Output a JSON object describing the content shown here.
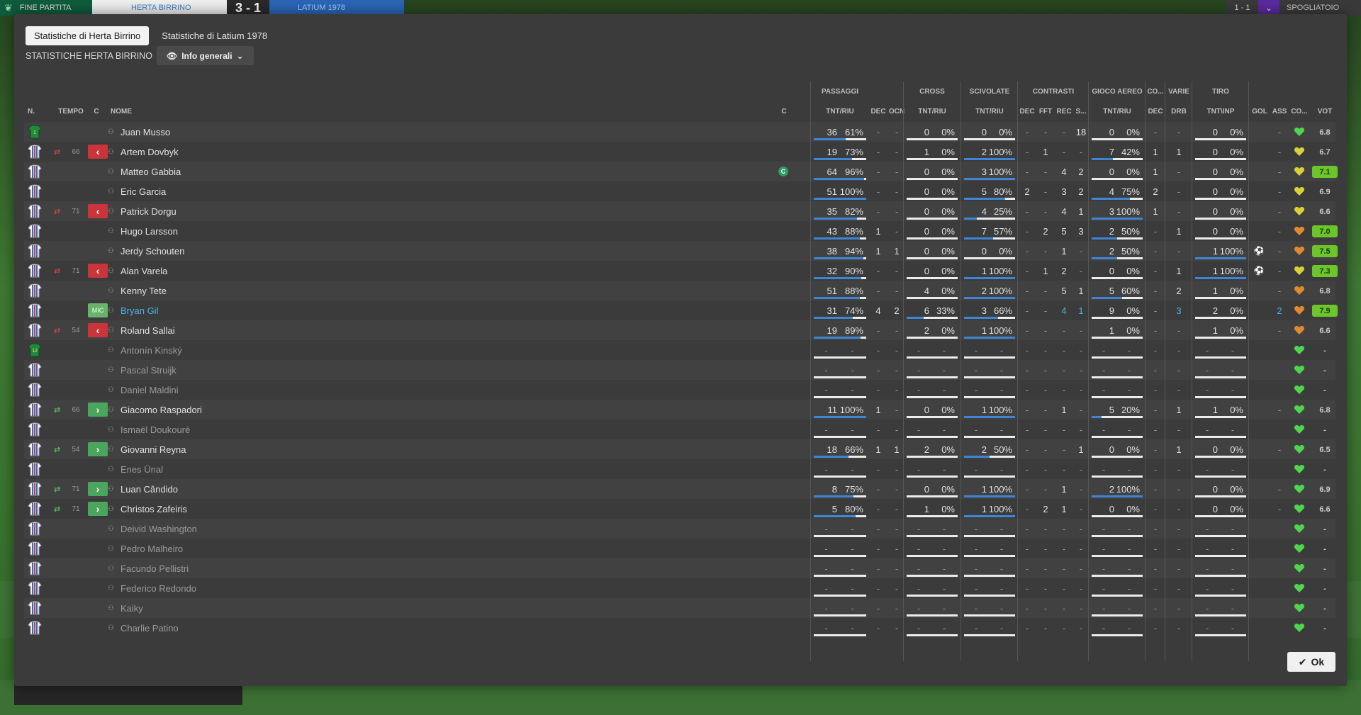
{
  "topbar": {
    "end_label": "FINE PARTITA",
    "home_team": "HERTA BIRRINO",
    "score": "3 - 1",
    "away_team": "LATIUM 1978",
    "right_score": "1 - 1",
    "right_label": "SPOGLIATOIO"
  },
  "tabs": [
    {
      "label": "Statistiche di Herta Birrino",
      "active": true
    },
    {
      "label": "Statistiche di Latium 1978",
      "active": false
    }
  ],
  "section_label": "STATISTICHE HERTA BIRRINO",
  "view_dropdown": "Info generali",
  "groups": [
    "PASSAGGI",
    "CROSS",
    "SCIVOLATE",
    "CONTRASTI",
    "GIOCO AEREO",
    "CO...",
    "VARIE",
    "TIRO"
  ],
  "headers": {
    "n": "N.",
    "tempo": "TEMPO",
    "c": "C",
    "nome": "NOME",
    "cap": "C",
    "p_tnt": "TNT/RIU",
    "p_dec": "DEC",
    "p_ocn": "OCN",
    "cr_tnt": "TNT/RIU",
    "sc_tnt": "TNT/RIU",
    "co_dec": "DEC",
    "co_fft": "FFT",
    "co_rec": "REC",
    "co_s": "S...",
    "ga_tnt": "TNT/RIU",
    "cm_dec": "DEC",
    "va_drb": "DRB",
    "ti_tnt": "TNT\\INP",
    "gol": "GOL",
    "ass": "ASS",
    "cond": "CO...",
    "vot": "VOT"
  },
  "players": [
    {
      "num": "1",
      "gk": true,
      "sub": "",
      "min": "",
      "pos": "",
      "name": "Juan Musso",
      "dim": false,
      "link": false,
      "cap": false,
      "p": [
        "36",
        "61%"
      ],
      "pdec": "-",
      "pocn": "-",
      "cr": [
        "0",
        "0%"
      ],
      "sc": [
        "0",
        "0%"
      ],
      "codec": "-",
      "cofft": "-",
      "corec": "-",
      "cos": "18",
      "ga": [
        "0",
        "0%"
      ],
      "cmdec": "-",
      "drb": "-",
      "ti": [
        "0",
        "0%"
      ],
      "gol": "",
      "ass": "-",
      "heart": "green",
      "vot": "6.8",
      "hi": false,
      "pfill": 61,
      "crfill": 0,
      "scfill": 0,
      "gafill": 0,
      "tifill": 0
    },
    {
      "num": "",
      "gk": false,
      "sub": "out",
      "min": "66",
      "pos": "",
      "name": "Artem Dovbyk",
      "dim": false,
      "link": false,
      "cap": false,
      "p": [
        "19",
        "73%"
      ],
      "pdec": "-",
      "pocn": "-",
      "cr": [
        "1",
        "0%"
      ],
      "sc": [
        "2",
        "100%"
      ],
      "codec": "-",
      "cofft": "1",
      "corec": "-",
      "cos": "-",
      "ga": [
        "7",
        "42%"
      ],
      "cmdec": "1",
      "drb": "1",
      "ti": [
        "0",
        "0%"
      ],
      "gol": "",
      "ass": "-",
      "heart": "yellow",
      "vot": "6.7",
      "hi": false,
      "pfill": 73,
      "crfill": 0,
      "scfill": 100,
      "gafill": 42,
      "tifill": 0
    },
    {
      "num": "",
      "gk": false,
      "sub": "",
      "min": "",
      "pos": "",
      "name": "Matteo Gabbia",
      "dim": false,
      "link": false,
      "cap": true,
      "p": [
        "64",
        "96%"
      ],
      "pdec": "-",
      "pocn": "-",
      "cr": [
        "0",
        "0%"
      ],
      "sc": [
        "3",
        "100%"
      ],
      "codec": "-",
      "cofft": "-",
      "corec": "4",
      "cos": "2",
      "ga": [
        "0",
        "0%"
      ],
      "cmdec": "1",
      "drb": "-",
      "ti": [
        "0",
        "0%"
      ],
      "gol": "",
      "ass": "-",
      "heart": "yellow",
      "vot": "7.1",
      "hi": true,
      "pfill": 96,
      "crfill": 0,
      "scfill": 100,
      "gafill": 0,
      "tifill": 0
    },
    {
      "num": "",
      "gk": false,
      "sub": "",
      "min": "",
      "pos": "",
      "name": "Eric Garcia",
      "dim": false,
      "link": false,
      "cap": false,
      "p": [
        "51",
        "100%"
      ],
      "pdec": "-",
      "pocn": "-",
      "cr": [
        "0",
        "0%"
      ],
      "sc": [
        "5",
        "80%"
      ],
      "codec": "2",
      "cofft": "-",
      "corec": "3",
      "cos": "2",
      "ga": [
        "4",
        "75%"
      ],
      "cmdec": "2",
      "drb": "-",
      "ti": [
        "0",
        "0%"
      ],
      "gol": "",
      "ass": "-",
      "heart": "yellow",
      "vot": "6.9",
      "hi": false,
      "pfill": 100,
      "crfill": 0,
      "scfill": 80,
      "gafill": 75,
      "tifill": 0
    },
    {
      "num": "",
      "gk": false,
      "sub": "out",
      "min": "71",
      "pos": "",
      "name": "Patrick Dorgu",
      "dim": false,
      "link": false,
      "cap": false,
      "p": [
        "35",
        "82%"
      ],
      "pdec": "-",
      "pocn": "-",
      "cr": [
        "0",
        "0%"
      ],
      "sc": [
        "4",
        "25%"
      ],
      "codec": "-",
      "cofft": "-",
      "corec": "4",
      "cos": "1",
      "ga": [
        "3",
        "100%"
      ],
      "cmdec": "1",
      "drb": "-",
      "ti": [
        "0",
        "0%"
      ],
      "gol": "",
      "ass": "-",
      "heart": "yellow",
      "vot": "6.6",
      "hi": false,
      "pfill": 82,
      "crfill": 0,
      "scfill": 25,
      "gafill": 100,
      "tifill": 0
    },
    {
      "num": "",
      "gk": false,
      "sub": "",
      "min": "",
      "pos": "",
      "name": "Hugo Larsson",
      "dim": false,
      "link": false,
      "cap": false,
      "p": [
        "43",
        "88%"
      ],
      "pdec": "1",
      "pocn": "-",
      "cr": [
        "0",
        "0%"
      ],
      "sc": [
        "7",
        "57%"
      ],
      "codec": "-",
      "cofft": "2",
      "corec": "5",
      "cos": "3",
      "ga": [
        "2",
        "50%"
      ],
      "cmdec": "-",
      "drb": "1",
      "ti": [
        "0",
        "0%"
      ],
      "gol": "",
      "ass": "-",
      "heart": "orange",
      "vot": "7.0",
      "hi": true,
      "pfill": 88,
      "crfill": 0,
      "scfill": 57,
      "gafill": 50,
      "tifill": 0
    },
    {
      "num": "",
      "gk": false,
      "sub": "",
      "min": "",
      "pos": "",
      "name": "Jerdy Schouten",
      "dim": false,
      "link": false,
      "cap": false,
      "p": [
        "38",
        "94%"
      ],
      "pdec": "1",
      "pocn": "1",
      "cr": [
        "0",
        "0%"
      ],
      "sc": [
        "0",
        "0%"
      ],
      "codec": "-",
      "cofft": "-",
      "corec": "1",
      "cos": "-",
      "ga": [
        "2",
        "50%"
      ],
      "cmdec": "-",
      "drb": "-",
      "ti": [
        "1",
        "100%"
      ],
      "gol": "ball",
      "ass": "-",
      "heart": "orange",
      "vot": "7.5",
      "hi": true,
      "pfill": 94,
      "crfill": 0,
      "scfill": 0,
      "gafill": 50,
      "tifill": 100
    },
    {
      "num": "",
      "gk": false,
      "sub": "out",
      "min": "71",
      "pos": "",
      "name": "Alan Varela",
      "dim": false,
      "link": false,
      "cap": false,
      "p": [
        "32",
        "90%"
      ],
      "pdec": "-",
      "pocn": "-",
      "cr": [
        "0",
        "0%"
      ],
      "sc": [
        "1",
        "100%"
      ],
      "codec": "-",
      "cofft": "1",
      "corec": "2",
      "cos": "-",
      "ga": [
        "0",
        "0%"
      ],
      "cmdec": "-",
      "drb": "1",
      "ti": [
        "1",
        "100%"
      ],
      "gol": "ball",
      "ass": "-",
      "heart": "yellow",
      "vot": "7.3",
      "hi": true,
      "pfill": 90,
      "crfill": 0,
      "scfill": 100,
      "gafill": 0,
      "tifill": 100
    },
    {
      "num": "",
      "gk": false,
      "sub": "",
      "min": "",
      "pos": "",
      "name": "Kenny Tete",
      "dim": false,
      "link": false,
      "cap": false,
      "p": [
        "51",
        "88%"
      ],
      "pdec": "-",
      "pocn": "-",
      "cr": [
        "4",
        "0%"
      ],
      "sc": [
        "2",
        "100%"
      ],
      "codec": "-",
      "cofft": "-",
      "corec": "5",
      "cos": "1",
      "ga": [
        "5",
        "60%"
      ],
      "cmdec": "-",
      "drb": "2",
      "ti": [
        "1",
        "0%"
      ],
      "gol": "",
      "ass": "-",
      "heart": "orange",
      "vot": "6.8",
      "hi": false,
      "pfill": 88,
      "crfill": 0,
      "scfill": 100,
      "gafill": 60,
      "tifill": 0
    },
    {
      "num": "",
      "gk": false,
      "sub": "",
      "min": "",
      "pos": "MIC",
      "name": "Bryan Gil",
      "dim": false,
      "link": true,
      "cap": false,
      "p": [
        "31",
        "74%"
      ],
      "pdec": "4",
      "pocn": "2",
      "cr": [
        "6",
        "33%"
      ],
      "sc": [
        "3",
        "66%"
      ],
      "codec": "-",
      "cofft": "-",
      "corec": "4",
      "cos": "1",
      "ga": [
        "9",
        "0%"
      ],
      "cmdec": "-",
      "drb": "3",
      "ti": [
        "2",
        "0%"
      ],
      "gol": "",
      "ass": "2",
      "heart": "orange",
      "vot": "7.9",
      "hi": true,
      "pfill": 74,
      "crfill": 33,
      "scfill": 66,
      "gafill": 0,
      "tifill": 0
    },
    {
      "num": "",
      "gk": false,
      "sub": "out",
      "min": "54",
      "pos": "",
      "name": "Roland Sallai",
      "dim": false,
      "link": false,
      "cap": false,
      "p": [
        "19",
        "89%"
      ],
      "pdec": "-",
      "pocn": "-",
      "cr": [
        "2",
        "0%"
      ],
      "sc": [
        "1",
        "100%"
      ],
      "codec": "-",
      "cofft": "-",
      "corec": "-",
      "cos": "-",
      "ga": [
        "1",
        "0%"
      ],
      "cmdec": "-",
      "drb": "-",
      "ti": [
        "1",
        "0%"
      ],
      "gol": "",
      "ass": "-",
      "heart": "orange",
      "vot": "6.6",
      "hi": false,
      "pfill": 89,
      "crfill": 0,
      "scfill": 100,
      "gafill": 0,
      "tifill": 0
    },
    {
      "num": "12",
      "gk": true,
      "sub": "",
      "min": "",
      "pos": "",
      "name": "Antonín Kinský",
      "dim": true,
      "link": false,
      "cap": false,
      "empty": true,
      "heart": "green",
      "vot": "-"
    },
    {
      "num": "",
      "gk": false,
      "sub": "",
      "min": "",
      "pos": "",
      "name": "Pascal Struijk",
      "dim": true,
      "link": false,
      "cap": false,
      "empty": true,
      "heart": "green",
      "vot": "-"
    },
    {
      "num": "",
      "gk": false,
      "sub": "",
      "min": "",
      "pos": "",
      "name": "Daniel Maldini",
      "dim": true,
      "link": false,
      "cap": false,
      "empty": true,
      "heart": "green",
      "vot": "-"
    },
    {
      "num": "",
      "gk": false,
      "sub": "in",
      "min": "66",
      "pos": "",
      "name": "Giacomo Raspadori",
      "dim": false,
      "link": false,
      "cap": false,
      "p": [
        "11",
        "100%"
      ],
      "pdec": "1",
      "pocn": "-",
      "cr": [
        "0",
        "0%"
      ],
      "sc": [
        "1",
        "100%"
      ],
      "codec": "-",
      "cofft": "-",
      "corec": "1",
      "cos": "-",
      "ga": [
        "5",
        "20%"
      ],
      "cmdec": "-",
      "drb": "1",
      "ti": [
        "1",
        "0%"
      ],
      "gol": "",
      "ass": "-",
      "heart": "green",
      "vot": "6.8",
      "hi": false,
      "pfill": 100,
      "crfill": 0,
      "scfill": 100,
      "gafill": 20,
      "tifill": 0
    },
    {
      "num": "",
      "gk": false,
      "sub": "",
      "min": "",
      "pos": "",
      "name": "Ismaël Doukouré",
      "dim": true,
      "link": false,
      "cap": false,
      "empty": true,
      "heart": "green",
      "vot": "-"
    },
    {
      "num": "",
      "gk": false,
      "sub": "in",
      "min": "54",
      "pos": "",
      "name": "Giovanni Reyna",
      "dim": false,
      "link": false,
      "cap": false,
      "p": [
        "18",
        "66%"
      ],
      "pdec": "1",
      "pocn": "1",
      "cr": [
        "2",
        "0%"
      ],
      "sc": [
        "2",
        "50%"
      ],
      "codec": "-",
      "cofft": "-",
      "corec": "-",
      "cos": "1",
      "ga": [
        "0",
        "0%"
      ],
      "cmdec": "-",
      "drb": "1",
      "ti": [
        "0",
        "0%"
      ],
      "gol": "",
      "ass": "-",
      "heart": "green",
      "vot": "6.5",
      "hi": false,
      "pfill": 66,
      "crfill": 0,
      "scfill": 50,
      "gafill": 0,
      "tifill": 0
    },
    {
      "num": "",
      "gk": false,
      "sub": "",
      "min": "",
      "pos": "",
      "name": "Enes Ünal",
      "dim": true,
      "link": false,
      "cap": false,
      "empty": true,
      "heart": "green",
      "vot": "-"
    },
    {
      "num": "",
      "gk": false,
      "sub": "in",
      "min": "71",
      "pos": "",
      "name": "Luan Cândido",
      "dim": false,
      "link": false,
      "cap": false,
      "p": [
        "8",
        "75%"
      ],
      "pdec": "-",
      "pocn": "-",
      "cr": [
        "0",
        "0%"
      ],
      "sc": [
        "1",
        "100%"
      ],
      "codec": "-",
      "cofft": "-",
      "corec": "1",
      "cos": "-",
      "ga": [
        "2",
        "100%"
      ],
      "cmdec": "-",
      "drb": "-",
      "ti": [
        "0",
        "0%"
      ],
      "gol": "",
      "ass": "-",
      "heart": "green",
      "vot": "6.9",
      "hi": false,
      "pfill": 75,
      "crfill": 0,
      "scfill": 100,
      "gafill": 100,
      "tifill": 0
    },
    {
      "num": "",
      "gk": false,
      "sub": "in",
      "min": "71",
      "pos": "",
      "name": "Christos Zafeiris",
      "dim": false,
      "link": false,
      "cap": false,
      "p": [
        "5",
        "80%"
      ],
      "pdec": "-",
      "pocn": "-",
      "cr": [
        "1",
        "0%"
      ],
      "sc": [
        "1",
        "100%"
      ],
      "codec": "-",
      "cofft": "2",
      "corec": "1",
      "cos": "-",
      "ga": [
        "0",
        "0%"
      ],
      "cmdec": "-",
      "drb": "-",
      "ti": [
        "0",
        "0%"
      ],
      "gol": "",
      "ass": "-",
      "heart": "green",
      "vot": "6.6",
      "hi": false,
      "pfill": 80,
      "crfill": 0,
      "scfill": 100,
      "gafill": 0,
      "tifill": 0
    },
    {
      "num": "",
      "gk": false,
      "sub": "",
      "min": "",
      "pos": "",
      "name": "Deivid Washington",
      "dim": true,
      "link": false,
      "cap": false,
      "empty": true,
      "heart": "green",
      "vot": "-"
    },
    {
      "num": "",
      "gk": false,
      "sub": "",
      "min": "",
      "pos": "",
      "name": "Pedro Malheiro",
      "dim": true,
      "link": false,
      "cap": false,
      "empty": true,
      "heart": "green",
      "vot": "-"
    },
    {
      "num": "",
      "gk": false,
      "sub": "",
      "min": "",
      "pos": "",
      "name": "Facundo Pellistri",
      "dim": true,
      "link": false,
      "cap": false,
      "empty": true,
      "heart": "green",
      "vot": "-"
    },
    {
      "num": "",
      "gk": false,
      "sub": "",
      "min": "",
      "pos": "",
      "name": "Federico Redondo",
      "dim": true,
      "link": false,
      "cap": false,
      "empty": true,
      "heart": "green",
      "vot": "-"
    },
    {
      "num": "",
      "gk": false,
      "sub": "",
      "min": "",
      "pos": "",
      "name": "Kaiky",
      "dim": true,
      "link": false,
      "cap": false,
      "empty": true,
      "heart": "green",
      "vot": "-"
    },
    {
      "num": "",
      "gk": false,
      "sub": "",
      "min": "",
      "pos": "",
      "name": "Charlie Patino",
      "dim": true,
      "link": false,
      "cap": false,
      "empty": true,
      "heart": "green",
      "vot": "-"
    }
  ],
  "ok_label": "Ok",
  "colors": {
    "accent_blue": "#3d86d6",
    "link": "#4ab3e6",
    "vote_high": "#6cc52a",
    "sub_in": "#4aa65c",
    "sub_out": "#c9353a"
  }
}
